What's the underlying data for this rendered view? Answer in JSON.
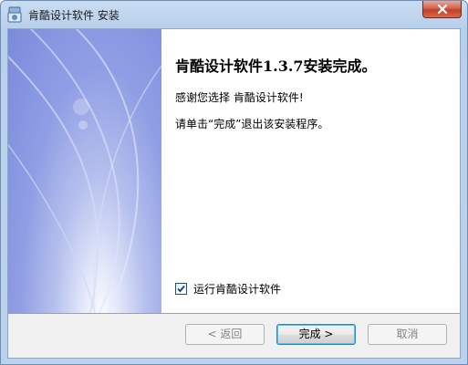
{
  "window": {
    "title": "肯酷设计软件 安装"
  },
  "icons": {
    "app": "installer-icon",
    "close": "close-icon",
    "check": "checkmark-icon"
  },
  "main": {
    "heading": "肯酷设计软件1.3.7安装完成。",
    "thanks": "感谢您选择 肯酷设计软件!",
    "instruction": "请单击“完成”退出该安装程序。",
    "run_checkbox": {
      "label": "运行肯酷设计软件",
      "checked": true
    }
  },
  "buttons": {
    "back": "< 返回",
    "finish": "完成 >",
    "cancel": "取消"
  }
}
